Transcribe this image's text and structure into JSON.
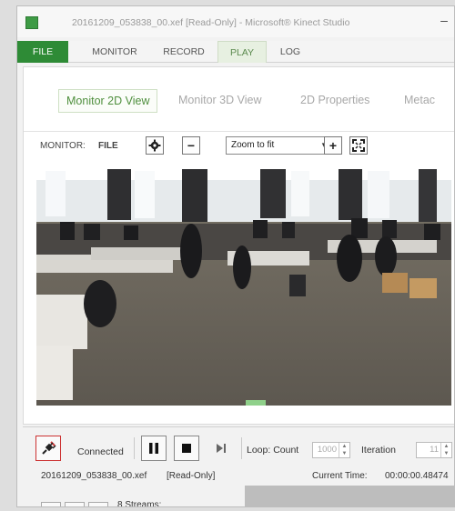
{
  "window": {
    "title": "20161209_053838_00.xef [Read-Only] - Microsoft® Kinect Studio",
    "minimize_glyph": "–"
  },
  "menu": {
    "items": [
      "FILE",
      "MONITOR",
      "RECORD",
      "PLAY",
      "LOG"
    ],
    "active": "PLAY"
  },
  "tabs": {
    "items": [
      "Monitor 2D View",
      "Monitor 3D View",
      "2D Properties",
      "Metac"
    ],
    "active": "Monitor 2D View"
  },
  "view_toolbar": {
    "monitor_label": "MONITOR:",
    "monitor_value": "FILE",
    "settings_icon": "gear-icon",
    "zoom_out_glyph": "−",
    "zoom_select_value": "Zoom to fit",
    "zoom_in_glyph": "+",
    "fullscreen_icon": "expand-icon"
  },
  "viewer": {
    "content": "kinect-color-frame-office"
  },
  "playback": {
    "connect_icon": "plug-icon",
    "connection_status": "Connected",
    "pause_icon": "pause-icon",
    "stop_icon": "stop-icon",
    "step_icon": "step-forward-icon",
    "loop_label": "Loop: Count",
    "loop_count": "1000",
    "iteration_label": "Iteration",
    "iteration_value": "11",
    "file_name": "20161209_053838_00.xef",
    "file_mode": "[Read-Only]",
    "current_time_label": "Current Time:",
    "current_time_value": "00:00:00.48474",
    "streams_label": "8 Streams:"
  },
  "colors": {
    "accent_green": "#2e8b36",
    "active_tab_green": "#4f8f3d"
  }
}
